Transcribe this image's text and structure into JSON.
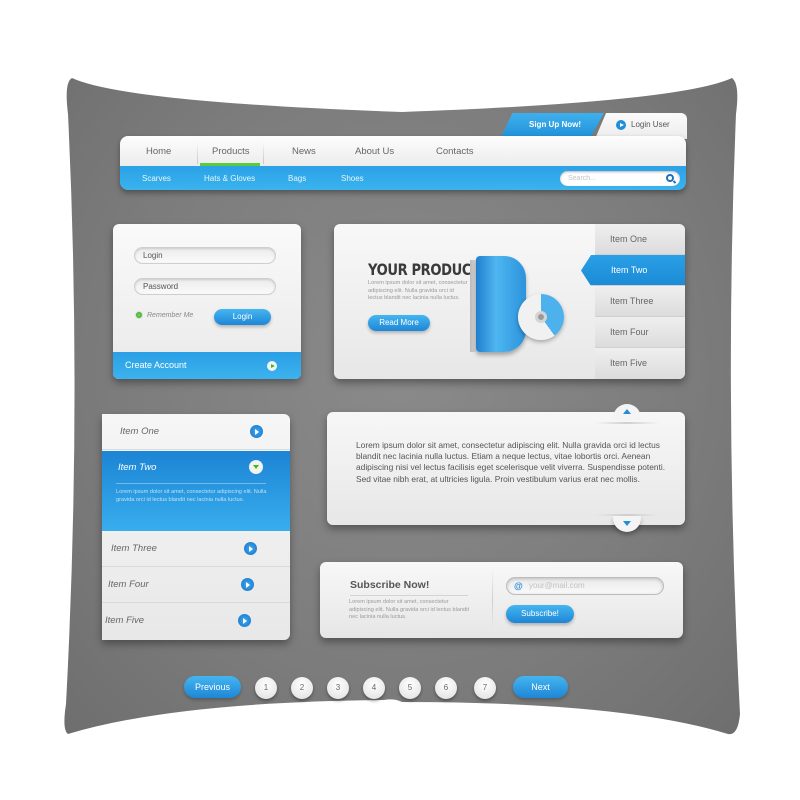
{
  "colors": {
    "accent_blue": "#2aa0e6",
    "active_green": "#5acb3d",
    "background_gray": "#7c7c7c",
    "panel_light": "#f4f4f4"
  },
  "top_nav": {
    "signup_label": "Sign Up Now!",
    "login_label": "Login User",
    "login_icon": "play-circle-icon",
    "main_items": [
      "Home",
      "Products",
      "News",
      "About Us",
      "Contacts"
    ],
    "active_main": "Products",
    "sub_items": [
      "Scarves",
      "Hats & Gloves",
      "Bags",
      "Shoes"
    ],
    "search_placeholder": "Search...",
    "search_icon": "search-icon"
  },
  "login_form": {
    "login_placeholder": "Login",
    "password_placeholder": "Password",
    "remember_label": "Remember Me",
    "login_button": "Login",
    "create_account_label": "Create Account",
    "create_account_icon": "play-circle-icon"
  },
  "product": {
    "title": "YOUR PRODUCT",
    "description": "Lorem ipsum dolor sit amet, consectetur adipiscing elit. Nulla gravida orci id lectus blandit nec lacinia nulla luctus.",
    "read_more_label": "Read More",
    "image": "software-box-with-disc",
    "menu_items": [
      "Item One",
      "Item Two",
      "Item Three",
      "Item Four",
      "Item Five"
    ],
    "active_menu": "Item Two"
  },
  "accordion": {
    "items": [
      "Item One",
      "Item Two",
      "Item Three",
      "Item Four",
      "Item Five"
    ],
    "open_item": "Item Two",
    "open_description": "Lorem ipsum dolor sit amet, consectetur adipiscing elit. Nulla gravida orci id lectus blandit nec lacinia nulla luctus.",
    "item_icon": "play-circle-icon",
    "open_icon": "chevron-down-circle-icon"
  },
  "text_panel": {
    "body": "Lorem ipsum dolor sit amet, consectetur adipiscing elit. Nulla gravida orci id lectus blandit nec lacinia nulla luctus. Etiam a neque lectus, vitae lobortis orci. Aenean adipiscing nisi vel lectus facilisis eget scelerisque velit viverra. Suspendisse potenti. Sed vitae nibh erat, at ultricies ligula. Proin vestibulum varius erat nec mollis.",
    "scroll_up_icon": "arrow-up-icon",
    "scroll_down_icon": "arrow-down-icon"
  },
  "subscribe": {
    "title": "Subscribe Now!",
    "description": "Lorem ipsum dolor sit amet, consectetur adipiscing elit. Nulla gravida orci id lectus blandit nec lacinia nulla luctus.",
    "email_placeholder": "your@mail.com",
    "email_icon": "at-sign-icon",
    "button_label": "Subscribe!"
  },
  "pagination": {
    "previous_label": "Previous",
    "next_label": "Next",
    "pages": [
      "1",
      "2",
      "3",
      "4",
      "5",
      "6",
      "7"
    ]
  }
}
